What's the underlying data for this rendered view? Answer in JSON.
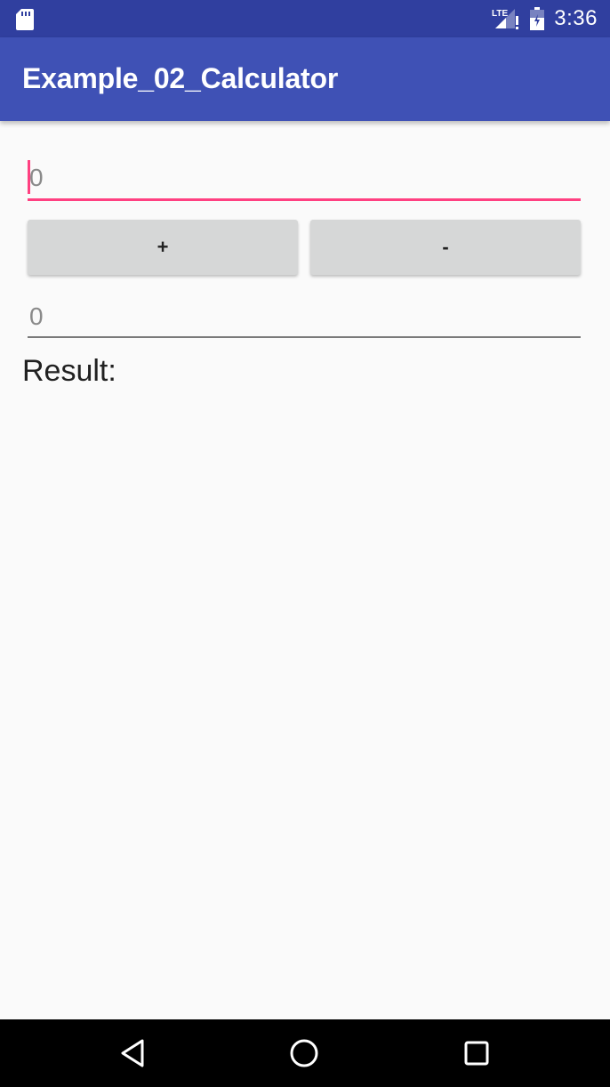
{
  "status_bar": {
    "time": "3:36",
    "icons": [
      "sd-card-icon",
      "lte-signal-icon",
      "battery-icon"
    ],
    "network_label": "LTE"
  },
  "app_bar": {
    "title": "Example_02_Calculator"
  },
  "form": {
    "first_input": {
      "value": "",
      "placeholder": "0"
    },
    "second_input": {
      "value": "",
      "placeholder": "0"
    },
    "plus_label": "+",
    "minus_label": "-",
    "result_label": "Result:"
  },
  "nav_bar": {
    "icons": [
      "back-icon",
      "home-icon",
      "recents-icon"
    ]
  },
  "colors": {
    "status_bar": "#303f9f",
    "app_bar": "#3f51b5",
    "accent": "#ff4081",
    "background": "#fafafa",
    "button": "#d6d7d7"
  }
}
